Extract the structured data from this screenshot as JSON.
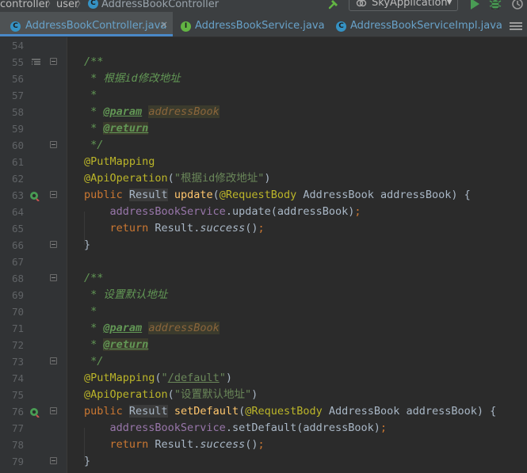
{
  "navbar": {
    "crumbs": [
      "controller",
      "user",
      "AddressBookController"
    ],
    "class_badge": "C",
    "run_config": "SkyApplication"
  },
  "tabs": [
    {
      "badge": "C",
      "label": "AddressBookController.java",
      "close": "×"
    },
    {
      "badge": "I",
      "label": "AddressBookService.java"
    },
    {
      "badge": "C",
      "label": "AddressBookServiceImpl.java"
    }
  ],
  "editor": {
    "lines": [
      {
        "n": "54"
      },
      {
        "n": "55",
        "doc_open": "/**"
      },
      {
        "n": "56",
        "comment": " * 根据id修改地址"
      },
      {
        "n": "57",
        "comment": " *"
      },
      {
        "n": "58",
        "star": " * ",
        "tag": "@param",
        "tagval": "addressBook"
      },
      {
        "n": "59",
        "star": " * ",
        "tag": "@return"
      },
      {
        "n": "60",
        "comment": " */"
      },
      {
        "n": "61",
        "ann": "@PutMapping"
      },
      {
        "n": "62",
        "ann": "@ApiOperation",
        "p1": "(",
        "str": "\"根据id修改地址\"",
        "p2": ")"
      },
      {
        "n": "63",
        "kw": "public ",
        "type": "Result",
        "sp": " ",
        "fn": "update",
        "p1": "(",
        "ann": "@RequestBody",
        "rest": " AddressBook addressBook) {"
      },
      {
        "n": "64",
        "indent": "    ",
        "field": "addressBookService",
        "rest": ".update(addressBook)",
        "semi": ";"
      },
      {
        "n": "65",
        "indent": "    ",
        "kw": "return ",
        "cls": "Result.",
        "static": "success",
        "rest": "()",
        "semi": ";"
      },
      {
        "n": "66",
        "rest": "}"
      },
      {
        "n": "67"
      },
      {
        "n": "68",
        "doc_open": "/**"
      },
      {
        "n": "69",
        "comment": " * 设置默认地址"
      },
      {
        "n": "70",
        "comment": " *"
      },
      {
        "n": "71",
        "star": " * ",
        "tag": "@param",
        "tagval": "addressBook"
      },
      {
        "n": "72",
        "star": " * ",
        "tag": "@return"
      },
      {
        "n": "73",
        "comment": " */"
      },
      {
        "n": "74",
        "ann": "@PutMapping",
        "p1": "(",
        "str_q1": "\"",
        "link": "/default",
        "str_q2": "\"",
        "p2": ")"
      },
      {
        "n": "75",
        "ann": "@ApiOperation",
        "p1": "(",
        "str": "\"设置默认地址\"",
        "p2": ")"
      },
      {
        "n": "76",
        "kw": "public ",
        "type": "Result",
        "sp": " ",
        "fn": "setDefault",
        "p1": "(",
        "ann": "@RequestBody",
        "rest": " AddressBook addressBook) {"
      },
      {
        "n": "77",
        "indent": "    ",
        "field": "addressBookService",
        "rest": ".setDefault(addressBook)",
        "semi": ";"
      },
      {
        "n": "78",
        "indent": "    ",
        "kw": "return ",
        "cls": "Result.",
        "static": "success",
        "rest": "()",
        "semi": ";"
      },
      {
        "n": "79",
        "rest": "}"
      }
    ]
  },
  "colors": {
    "background": "#2b2b2b",
    "gutter": "#313335",
    "line_number": "#606366",
    "doc_comment": "#629755",
    "annotation": "#bbb529",
    "keyword": "#cc7832",
    "method": "#ffc66d",
    "field": "#9876aa",
    "string": "#6a8759",
    "tab_accent": "#4a88c7"
  },
  "icons": {
    "class": "class-c-icon",
    "interface": "interface-i-icon",
    "build": "hammer-icon",
    "run": "run-icon",
    "debug": "debug-bug-icon",
    "implementing": "implementing-method-icon",
    "doc_toggle": "render-doc-icon"
  }
}
